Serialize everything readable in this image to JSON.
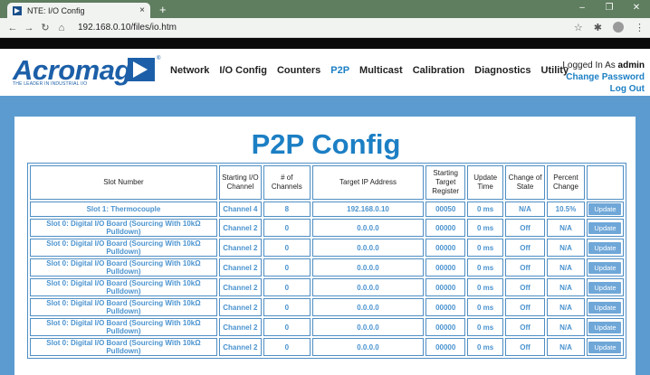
{
  "browser": {
    "tab_title": "NTE: I/O Config",
    "tab_close": "×",
    "new_tab": "+",
    "url": "192.168.0.10/files/io.htm",
    "controls": [
      "–",
      "❐",
      "✕"
    ]
  },
  "logo": {
    "wordmark": "Acromag",
    "tagline": "THE LEADER IN INDUSTRIAL I/O",
    "registered": "®"
  },
  "nav": {
    "items": [
      {
        "label": "Network",
        "active": false
      },
      {
        "label": "I/O Config",
        "active": false
      },
      {
        "label": "Counters",
        "active": false
      },
      {
        "label": "P2P",
        "active": true
      },
      {
        "label": "Multicast",
        "active": false
      },
      {
        "label": "Calibration",
        "active": false
      },
      {
        "label": "Diagnostics",
        "active": false
      },
      {
        "label": "Utility",
        "active": false
      }
    ]
  },
  "user": {
    "logged_in_prefix": "Logged In As ",
    "username": "admin",
    "change_password": "Change Password",
    "log_out": "Log Out"
  },
  "page": {
    "title": "P2P Config"
  },
  "table": {
    "headers": [
      "Slot Number",
      "Starting I/O Channel",
      "# of Channels",
      "Target IP Address",
      "Starting Target Register",
      "Update Time",
      "Change of State",
      "Percent Change",
      ""
    ],
    "rows": [
      {
        "slot": "Slot 1: Thermocouple",
        "channel": "Channel 4",
        "count": "8",
        "ip": "192.168.0.10",
        "register": "00050",
        "update_time": "0 ms",
        "cos": "N/A",
        "percent": "10.5%",
        "button": "Update"
      },
      {
        "slot": "Slot 0: Digital I/O Board (Sourcing With 10kΩ Pulldown)",
        "channel": "Channel 2",
        "count": "0",
        "ip": "0.0.0.0",
        "register": "00000",
        "update_time": "0 ms",
        "cos": "Off",
        "percent": "N/A",
        "button": "Update"
      },
      {
        "slot": "Slot 0: Digital I/O Board (Sourcing With 10kΩ Pulldown)",
        "channel": "Channel 2",
        "count": "0",
        "ip": "0.0.0.0",
        "register": "00000",
        "update_time": "0 ms",
        "cos": "Off",
        "percent": "N/A",
        "button": "Update"
      },
      {
        "slot": "Slot 0: Digital I/O Board (Sourcing With 10kΩ Pulldown)",
        "channel": "Channel 2",
        "count": "0",
        "ip": "0.0.0.0",
        "register": "00000",
        "update_time": "0 ms",
        "cos": "Off",
        "percent": "N/A",
        "button": "Update"
      },
      {
        "slot": "Slot 0: Digital I/O Board (Sourcing With 10kΩ Pulldown)",
        "channel": "Channel 2",
        "count": "0",
        "ip": "0.0.0.0",
        "register": "00000",
        "update_time": "0 ms",
        "cos": "Off",
        "percent": "N/A",
        "button": "Update"
      },
      {
        "slot": "Slot 0: Digital I/O Board (Sourcing With 10kΩ Pulldown)",
        "channel": "Channel 2",
        "count": "0",
        "ip": "0.0.0.0",
        "register": "00000",
        "update_time": "0 ms",
        "cos": "Off",
        "percent": "N/A",
        "button": "Update"
      },
      {
        "slot": "Slot 0: Digital I/O Board (Sourcing With 10kΩ Pulldown)",
        "channel": "Channel 2",
        "count": "0",
        "ip": "0.0.0.0",
        "register": "00000",
        "update_time": "0 ms",
        "cos": "Off",
        "percent": "N/A",
        "button": "Update"
      },
      {
        "slot": "Slot 0: Digital I/O Board (Sourcing With 10kΩ Pulldown)",
        "channel": "Channel 2",
        "count": "0",
        "ip": "0.0.0.0",
        "register": "00000",
        "update_time": "0 ms",
        "cos": "Off",
        "percent": "N/A",
        "button": "Update"
      }
    ]
  },
  "colors": {
    "brand_blue": "#1c5fa8",
    "accent_blue": "#1c7fc4",
    "content_bg": "#5c9bd0",
    "cell_text": "#4a93cf",
    "button_bg": "#6fa7d8"
  },
  "icons": [
    "favicon-icon",
    "back-icon",
    "forward-icon",
    "reload-icon",
    "home-icon",
    "star-icon",
    "extensions-icon",
    "profile-icon",
    "menu-icon"
  ]
}
